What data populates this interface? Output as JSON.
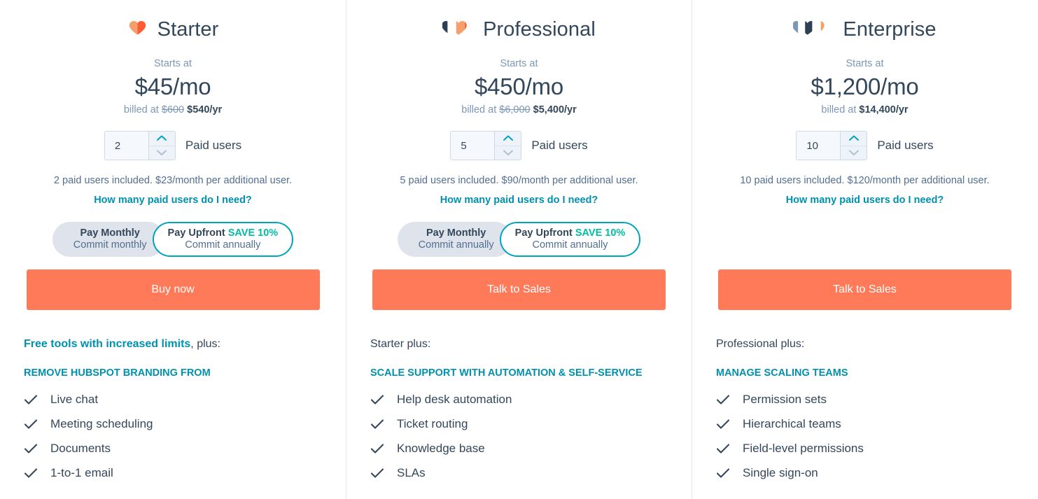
{
  "plans": [
    {
      "id": "starter",
      "name": "Starter",
      "icon": "heart-single-icon",
      "starts_at_label": "Starts at",
      "price": "$45/mo",
      "billed_prefix": "billed at",
      "billed_old": "$600",
      "billed_new": "$540/yr",
      "seats_value": "2",
      "seats_label": "Paid users",
      "included_note": "2 paid users included. $23/month per additional user.",
      "help_link": "How many paid users do I need?",
      "toggle": {
        "monthly_title": "Pay Monthly",
        "monthly_sub": "Commit monthly",
        "upfront_title": "Pay Upfront",
        "upfront_badge": "SAVE 10%",
        "upfront_sub": "Commit annually",
        "selected": "upfront"
      },
      "cta_label": "Buy now",
      "intro_link": "Free tools with increased limits",
      "intro_rest": ", plus:",
      "features_heading": "REMOVE HUBSPOT BRANDING FROM",
      "features": [
        "Live chat",
        "Meeting scheduling",
        "Documents",
        "1-to-1 email"
      ]
    },
    {
      "id": "professional",
      "name": "Professional",
      "icon": "heart-double-icon",
      "starts_at_label": "Starts at",
      "price": "$450/mo",
      "billed_prefix": "billed at",
      "billed_old": "$6,000",
      "billed_new": "$5,400/yr",
      "seats_value": "5",
      "seats_label": "Paid users",
      "included_note": "5 paid users included. $90/month per additional user.",
      "help_link": "How many paid users do I need?",
      "toggle": {
        "monthly_title": "Pay Monthly",
        "monthly_sub": "Commit annually",
        "upfront_title": "Pay Upfront",
        "upfront_badge": "SAVE 10%",
        "upfront_sub": "Commit annually",
        "selected": "upfront"
      },
      "cta_label": "Talk to Sales",
      "intro_link": "",
      "intro_rest": "Starter plus:",
      "features_heading": "SCALE SUPPORT WITH AUTOMATION & SELF-SERVICE",
      "features": [
        "Help desk automation",
        "Ticket routing",
        "Knowledge base",
        "SLAs"
      ]
    },
    {
      "id": "enterprise",
      "name": "Enterprise",
      "icon": "heart-triple-icon",
      "starts_at_label": "Starts at",
      "price": "$1,200/mo",
      "billed_prefix": "billed at",
      "billed_old": "",
      "billed_new": "$14,400/yr",
      "seats_value": "10",
      "seats_label": "Paid users",
      "included_note": "10 paid users included. $120/month per additional user.",
      "help_link": "How many paid users do I need?",
      "toggle": null,
      "cta_label": "Talk to Sales",
      "intro_link": "",
      "intro_rest": "Professional plus:",
      "features_heading": "MANAGE SCALING TEAMS",
      "features": [
        "Permission sets",
        "Hierarchical teams",
        "Field-level permissions",
        "Single sign-on"
      ]
    }
  ],
  "colors": {
    "cta": "#ff7a59",
    "link_teal": "#0091ae",
    "save_teal": "#00bda5",
    "border_teal": "#00a4bd",
    "navy": "#33475b",
    "muted": "#7c98b6",
    "heart_light": "#f5a06a",
    "heart_dark": "#ff5c35",
    "heart_navy": "#2e3f56",
    "heart_slate": "#7c98b6",
    "divider": "#e5e5f0"
  }
}
